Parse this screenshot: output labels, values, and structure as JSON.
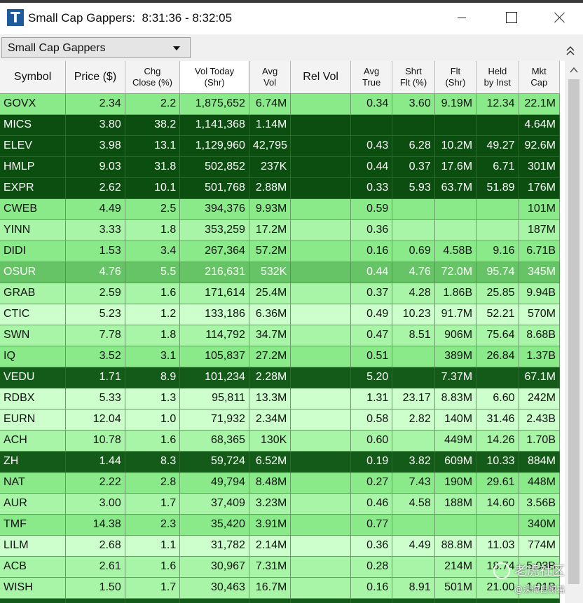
{
  "window": {
    "title": "Small Cap Gappers:  8:31:36 - 8:32:05",
    "icon_letter": "T"
  },
  "toolbar": {
    "strategy_selected": "Small Cap Gappers"
  },
  "columns": [
    {
      "key": "symbol",
      "label": "Symbol"
    },
    {
      "key": "price",
      "label": "Price ($)"
    },
    {
      "key": "chg",
      "label": "Chg\nClose (%)"
    },
    {
      "key": "vol",
      "label": "Vol Today\n(Shr)"
    },
    {
      "key": "avgvol",
      "label": "Avg\nVol"
    },
    {
      "key": "relvol",
      "label": "Rel Vol"
    },
    {
      "key": "avgtrue",
      "label": "Avg\nTrue"
    },
    {
      "key": "shrt",
      "label": "Shrt\nFlt (%)"
    },
    {
      "key": "flt",
      "label": "Flt\n(Shr)"
    },
    {
      "key": "held",
      "label": "Held\nby Inst"
    },
    {
      "key": "mktcap",
      "label": "Mkt\nCap"
    }
  ],
  "rows": [
    {
      "shade": "l3",
      "cells": [
        "GOVX",
        "2.34",
        "2.2",
        "1,875,652",
        "6.74M",
        "",
        "0.34",
        "3.60",
        "9.19M",
        "12.34",
        "22.1M"
      ]
    },
    {
      "shade": "d1",
      "cells": [
        "MICS",
        "3.80",
        "38.2",
        "1,141,368",
        "1.14M",
        "",
        "",
        "",
        "",
        "",
        "4.64M"
      ]
    },
    {
      "shade": "d1",
      "cells": [
        "ELEV",
        "3.98",
        "13.1",
        "1,129,960",
        "42,795",
        "",
        "0.43",
        "6.28",
        "10.2M",
        "49.27",
        "92.6M"
      ]
    },
    {
      "shade": "d1",
      "cells": [
        "HMLP",
        "9.03",
        "31.8",
        "502,852",
        "237K",
        "",
        "0.44",
        "0.37",
        "17.6M",
        "6.71",
        "301M"
      ]
    },
    {
      "shade": "d1",
      "cells": [
        "EXPR",
        "2.62",
        "10.1",
        "501,768",
        "2.88M",
        "",
        "0.33",
        "5.93",
        "63.7M",
        "51.89",
        "176M"
      ]
    },
    {
      "shade": "l3",
      "cells": [
        "CWEB",
        "4.49",
        "2.5",
        "394,376",
        "9.93M",
        "",
        "0.59",
        "",
        "",
        "",
        "101M"
      ]
    },
    {
      "shade": "l2",
      "cells": [
        "YINN",
        "3.33",
        "1.8",
        "353,259",
        "17.2M",
        "",
        "0.36",
        "",
        "",
        "",
        "187M"
      ]
    },
    {
      "shade": "l3",
      "cells": [
        "DIDI",
        "1.53",
        "3.4",
        "267,364",
        "57.2M",
        "",
        "0.16",
        "0.69",
        "4.58B",
        "9.16",
        "6.71B"
      ]
    },
    {
      "shade": "l4",
      "cells": [
        "OSUR",
        "4.76",
        "5.5",
        "216,631",
        "532K",
        "",
        "0.44",
        "4.76",
        "72.0M",
        "95.74",
        "345M"
      ]
    },
    {
      "shade": "l2",
      "cells": [
        "GRAB",
        "2.59",
        "1.6",
        "171,614",
        "25.4M",
        "",
        "0.37",
        "4.28",
        "1.86B",
        "25.85",
        "9.94B"
      ]
    },
    {
      "shade": "l1",
      "cells": [
        "CTIC",
        "5.23",
        "1.2",
        "133,186",
        "6.36M",
        "",
        "0.49",
        "10.23",
        "91.7M",
        "52.21",
        "570M"
      ]
    },
    {
      "shade": "l2",
      "cells": [
        "SWN",
        "7.78",
        "1.8",
        "114,792",
        "34.7M",
        "",
        "0.47",
        "8.51",
        "906M",
        "75.64",
        "8.68B"
      ]
    },
    {
      "shade": "l3",
      "cells": [
        "IQ",
        "3.52",
        "3.1",
        "105,837",
        "27.2M",
        "",
        "0.51",
        "",
        "389M",
        "26.84",
        "1.37B"
      ]
    },
    {
      "shade": "d2",
      "cells": [
        "VEDU",
        "1.71",
        "8.9",
        "101,234",
        "2.28M",
        "",
        "5.20",
        "",
        "7.37M",
        "",
        "67.1M"
      ]
    },
    {
      "shade": "l1",
      "cells": [
        "RDBX",
        "5.33",
        "1.3",
        "95,811",
        "13.3M",
        "",
        "1.31",
        "23.17",
        "8.83M",
        "6.60",
        "242M"
      ]
    },
    {
      "shade": "l1",
      "cells": [
        "EURN",
        "12.04",
        "1.0",
        "71,932",
        "2.34M",
        "",
        "0.58",
        "2.82",
        "140M",
        "31.46",
        "2.43B"
      ]
    },
    {
      "shade": "l2",
      "cells": [
        "ACH",
        "10.78",
        "1.6",
        "68,365",
        "130K",
        "",
        "0.60",
        "",
        "449M",
        "14.26",
        "1.70B"
      ]
    },
    {
      "shade": "d2",
      "cells": [
        "ZH",
        "1.44",
        "8.3",
        "59,724",
        "6.52M",
        "",
        "0.19",
        "3.82",
        "609M",
        "10.33",
        "884M"
      ]
    },
    {
      "shade": "l3",
      "cells": [
        "NAT",
        "2.22",
        "2.8",
        "49,794",
        "8.48M",
        "",
        "0.27",
        "7.43",
        "190M",
        "29.61",
        "448M"
      ]
    },
    {
      "shade": "l2",
      "cells": [
        "AUR",
        "3.00",
        "1.7",
        "37,409",
        "3.23M",
        "",
        "0.46",
        "4.58",
        "188M",
        "14.60",
        "3.56B"
      ]
    },
    {
      "shade": "l3",
      "cells": [
        "TMF",
        "14.38",
        "2.3",
        "35,420",
        "3.91M",
        "",
        "0.77",
        "",
        "",
        "",
        "340M"
      ]
    },
    {
      "shade": "l1",
      "cells": [
        "LILM",
        "2.68",
        "1.1",
        "31,782",
        "2.14M",
        "",
        "0.36",
        "4.49",
        "88.8M",
        "11.03",
        "774M"
      ]
    },
    {
      "shade": "l2",
      "cells": [
        "ACB",
        "2.61",
        "1.6",
        "30,967",
        "7.31M",
        "",
        "0.28",
        "",
        "214M",
        "18.74",
        "5.03B"
      ]
    },
    {
      "shade": "l2",
      "cells": [
        "WISH",
        "1.50",
        "1.7",
        "30,463",
        "16.7M",
        "",
        "0.16",
        "8.91",
        "501M",
        "21.00",
        "1.01B"
      ]
    },
    {
      "shade": "d2",
      "cells": [
        "",
        "",
        "",
        "",
        "",
        "",
        "",
        "",
        "",
        "",
        ""
      ]
    }
  ],
  "watermark": {
    "line1": "老虎社区",
    "line2": "@深海巨鲸猫"
  }
}
